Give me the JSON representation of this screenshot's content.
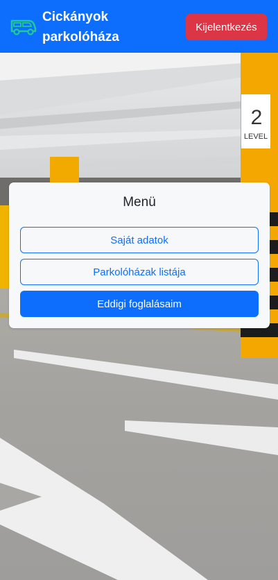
{
  "header": {
    "brand_line1": "Cickányok",
    "brand_line2": "parkolóháza",
    "logout_label": "Kijelentkezés",
    "brand_icon": "car-icon"
  },
  "background": {
    "level_number": "2",
    "level_text": "LEVEL"
  },
  "menu": {
    "title": "Menü",
    "items": [
      {
        "label": "Saját adatok",
        "style": "outline"
      },
      {
        "label": "Parkolóházak listája",
        "style": "outline"
      },
      {
        "label": "Eddigi foglalásaim",
        "style": "primary"
      }
    ]
  },
  "colors": {
    "primary": "#0d6efd",
    "danger": "#dc3545",
    "icon_accent": "#20c997"
  }
}
